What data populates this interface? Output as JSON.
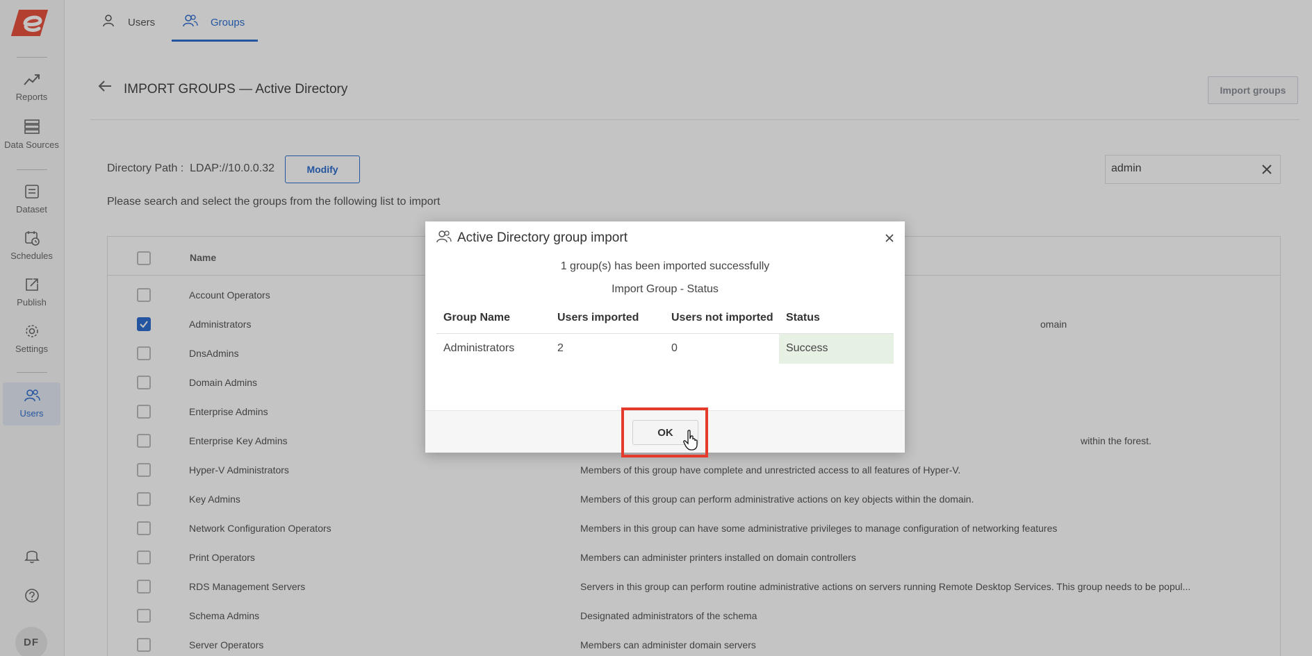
{
  "sidebar": {
    "items": [
      {
        "label": "Reports",
        "icon": "trend-icon"
      },
      {
        "label": "Data Sources",
        "icon": "database-icon"
      },
      {
        "label": "Dataset",
        "icon": "dataset-icon"
      },
      {
        "label": "Schedules",
        "icon": "calendar-clock-icon"
      },
      {
        "label": "Publish",
        "icon": "publish-icon"
      },
      {
        "label": "Settings",
        "icon": "gear-icon"
      },
      {
        "label": "Users",
        "icon": "users-icon",
        "active": true
      }
    ],
    "avatar_initials": "DF"
  },
  "tabs": [
    {
      "label": "Users",
      "active": false
    },
    {
      "label": "Groups",
      "active": true
    }
  ],
  "header": {
    "title": "IMPORT GROUPS — Active Directory",
    "import_button": "Import groups"
  },
  "directory": {
    "label": "Directory Path :",
    "path": "LDAP://10.0.0.32",
    "modify_button": "Modify",
    "instructions": "Please search and select the groups from the following list to import"
  },
  "search": {
    "value": "admin"
  },
  "table": {
    "column_name": "Name",
    "rows": [
      {
        "name": "Account Operators",
        "description": "",
        "checked": false
      },
      {
        "name": "Administrators",
        "description": "omain",
        "checked": true
      },
      {
        "name": "DnsAdmins",
        "description": "",
        "checked": false
      },
      {
        "name": "Domain Admins",
        "description": "",
        "checked": false
      },
      {
        "name": "Enterprise Admins",
        "description": "",
        "checked": false
      },
      {
        "name": "Enterprise Key Admins",
        "description": "within the forest.",
        "checked": false
      },
      {
        "name": "Hyper-V Administrators",
        "description": "Members of this group have complete and unrestricted access to all features of Hyper-V.",
        "checked": false
      },
      {
        "name": "Key Admins",
        "description": "Members of this group can perform administrative actions on key objects within the domain.",
        "checked": false
      },
      {
        "name": "Network Configuration Operators",
        "description": "Members in this group can have some administrative privileges to manage configuration of networking features",
        "checked": false
      },
      {
        "name": "Print Operators",
        "description": "Members can administer printers installed on domain controllers",
        "checked": false
      },
      {
        "name": "RDS Management Servers",
        "description": "Servers in this group can perform routine administrative actions on servers running Remote Desktop Services. This group needs to be popul...",
        "checked": false
      },
      {
        "name": "Schema Admins",
        "description": "Designated administrators of the schema",
        "checked": false
      },
      {
        "name": "Server Operators",
        "description": "Members can administer domain servers",
        "checked": false
      }
    ]
  },
  "dialog": {
    "title": "Active Directory group import",
    "message": "1 group(s) has been imported successfully",
    "subtitle": "Import Group - Status",
    "columns": [
      "Group Name",
      "Users imported",
      "Users not imported",
      "Status"
    ],
    "rows": [
      {
        "group": "Administrators",
        "imported": "2",
        "not_imported": "0",
        "status": "Success"
      }
    ],
    "ok_button": "OK"
  },
  "colors": {
    "accent": "#2f6fd0",
    "highlight": "#e53b2c",
    "success_bg": "#e6f0e3"
  }
}
